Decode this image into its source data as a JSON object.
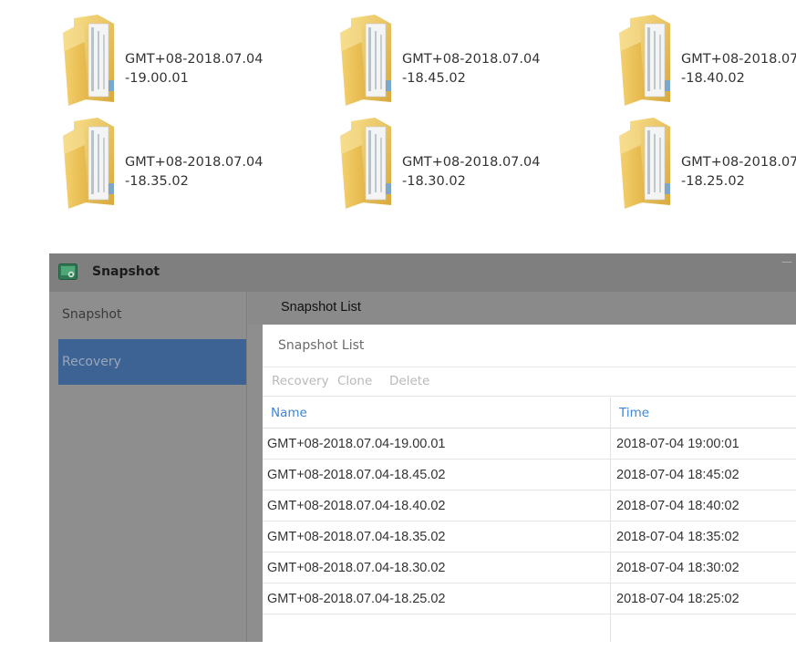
{
  "folders": [
    {
      "line1": "GMT+08-2018.07.04",
      "line2": "-19.00.01"
    },
    {
      "line1": "GMT+08-2018.07.04",
      "line2": "-18.45.02"
    },
    {
      "line1": "GMT+08-2018.07",
      "line2": "-18.40.02"
    },
    {
      "line1": "GMT+08-2018.07.04",
      "line2": "-18.35.02"
    },
    {
      "line1": "GMT+08-2018.07.04",
      "line2": "-18.30.02"
    },
    {
      "line1": "GMT+08-2018.07",
      "line2": "-18.25.02"
    }
  ],
  "window": {
    "title": "Snapshot",
    "icon": "snapshot-app-icon",
    "minimize_glyph": "—"
  },
  "sidebar": {
    "items": [
      {
        "label": "Snapshot"
      },
      {
        "label": "Recovery",
        "selected": true
      }
    ]
  },
  "content": {
    "header": "Snapshot List",
    "panel_title": "Snapshot List",
    "toolbar": {
      "recovery": "Recovery",
      "clone": "Clone",
      "delete": "Delete"
    },
    "table": {
      "columns": [
        "Name",
        "Time"
      ],
      "rows": [
        {
          "name": "GMT+08-2018.07.04-19.00.01",
          "time": "2018-07-04 19:00:01"
        },
        {
          "name": "GMT+08-2018.07.04-18.45.02",
          "time": "2018-07-04 18:45:02"
        },
        {
          "name": "GMT+08-2018.07.04-18.40.02",
          "time": "2018-07-04 18:40:02"
        },
        {
          "name": "GMT+08-2018.07.04-18.35.02",
          "time": "2018-07-04 18:35:02"
        },
        {
          "name": "GMT+08-2018.07.04-18.30.02",
          "time": "2018-07-04 18:30:02"
        },
        {
          "name": "GMT+08-2018.07.04-18.25.02",
          "time": "2018-07-04 18:25:02"
        }
      ]
    }
  },
  "colors": {
    "accent_blue": "#3b86d6",
    "selected_nav": "#3d6395",
    "folder_yellow": "#f2cf6b"
  }
}
